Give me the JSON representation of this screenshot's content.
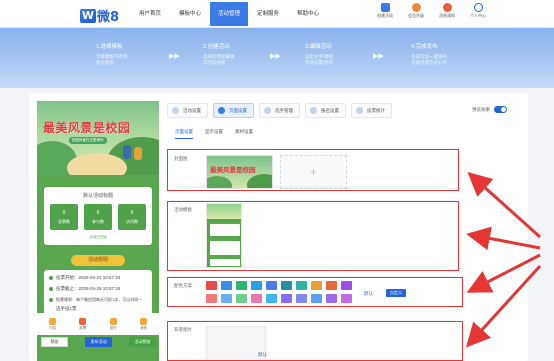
{
  "header": {
    "logo_mark": "W",
    "logo_text": "微8",
    "nav": [
      "用户首页",
      "模板中心",
      "活动管理",
      "定制服务",
      "帮助中心"
    ],
    "active_nav": 2,
    "icons": [
      {
        "label": "创建活动",
        "icon": "create-activity-icon",
        "color": "#3a7be8"
      },
      {
        "label": "会员升级",
        "icon": "vip-upgrade-icon",
        "color": "#e8623a"
      },
      {
        "label": "消息通知",
        "icon": "bell-icon",
        "color": "#e8623a"
      },
      {
        "label": "个人中心",
        "icon": "user-icon",
        "color": "#2563d8"
      }
    ]
  },
  "steps": [
    {
      "title": "1.选择模板",
      "desc": "丰富模板可选择\n套光看图"
    },
    {
      "title": "2.创建活动",
      "desc": "选择后直接编辑\n可活动创建"
    },
    {
      "title": "3.编辑活动",
      "desc": "设定文字/数据\n活动设置/组织"
    },
    {
      "title": "4.完成发布",
      "desc": "完成活动一键发布\n选择合适方式分享"
    }
  ],
  "phone": {
    "hero_title": "最美风景是校园",
    "hero_sub": "校园风景在这里等你",
    "card_title": "默认活动标题",
    "stats": [
      {
        "num": "0",
        "label": "总票数"
      },
      {
        "num": "6",
        "label": "参与数"
      },
      {
        "num": "0",
        "label": "访问数"
      }
    ],
    "vote_link": "活动已开始",
    "rules_title": "活动规则",
    "rules": [
      "投票开始：2025-04-22 10:57:34",
      "投票截止：2025-04-29 10:57:34",
      "投票规则：每个微信用每天可投1次，可以对同一",
      "选手投1票"
    ],
    "tabs": [
      {
        "label": "介绍",
        "color": "#f2a83a"
      },
      {
        "label": "投票",
        "color": "#e8623a"
      },
      {
        "label": "排行",
        "color": "#f2a83a"
      },
      {
        "label": "我的",
        "color": "#f2a83a"
      }
    ],
    "buttons": [
      "预览",
      "发布活动",
      "活动预览"
    ]
  },
  "config": {
    "top_tabs": [
      {
        "label": "活动设置",
        "active": false
      },
      {
        "label": "页面设置",
        "active": true
      },
      {
        "label": "选手管理",
        "active": false
      },
      {
        "label": "报名设置",
        "active": false
      },
      {
        "label": "投票统计",
        "active": false
      }
    ],
    "preview_label": "预览效果",
    "sub_tabs": [
      "页面设置",
      "显示设置",
      "素材设置"
    ],
    "rows": {
      "cover_label": "封面图",
      "cover_thumb_title": "最美风景是校园",
      "add_symbol": "+",
      "share_label": "活动模板",
      "color_label": "配色方案",
      "default_link": "默认",
      "custom_button": "自定义",
      "bg_label": "背景图片",
      "bg_default": "默认"
    },
    "swatches": [
      "#e84a4a",
      "#3a8ee8",
      "#2bb673",
      "#2b9ee8",
      "#4a7be8",
      "#2b8ea0",
      "#2bb6a0",
      "#e8a03a",
      "#e86a3a",
      "#a04ae8",
      "#f07878",
      "#68b0f0",
      "#6ed08a",
      "#e87ab0",
      "#3ab6e8",
      "#8a6af0",
      "#7a8af0",
      "#5aa0f0",
      "#a06ae8",
      "#c26ae8"
    ]
  }
}
